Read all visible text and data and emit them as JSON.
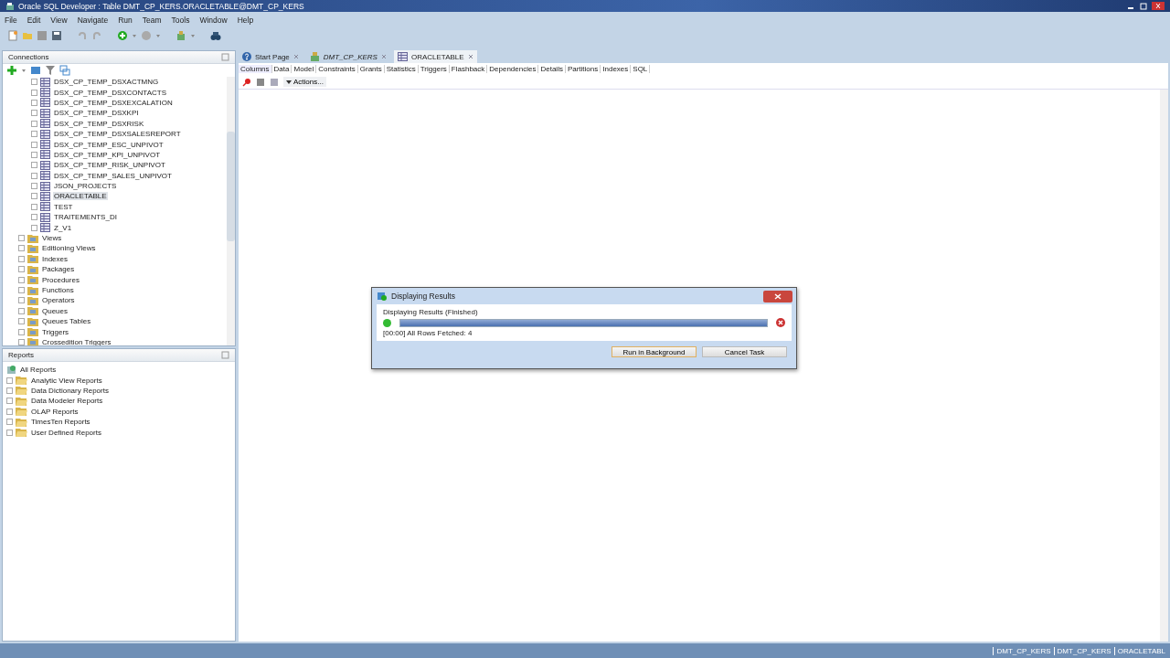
{
  "window": {
    "title": "Oracle SQL Developer : Table DMT_CP_KERS.ORACLETABLE@DMT_CP_KERS"
  },
  "menu": [
    "File",
    "Edit",
    "View",
    "Navigate",
    "Run",
    "Team",
    "Tools",
    "Window",
    "Help"
  ],
  "connections": {
    "title": "Connections",
    "tables": [
      {
        "label": "DSX_CP_TEMP_DSXACTMNG",
        "selected": false
      },
      {
        "label": "DSX_CP_TEMP_DSXCONTACTS",
        "selected": false
      },
      {
        "label": "DSX_CP_TEMP_DSXEXCALATION",
        "selected": false
      },
      {
        "label": "DSX_CP_TEMP_DSXKPI",
        "selected": false
      },
      {
        "label": "DSX_CP_TEMP_DSXRISK",
        "selected": false
      },
      {
        "label": "DSX_CP_TEMP_DSXSALESREPORT",
        "selected": false
      },
      {
        "label": "DSX_CP_TEMP_ESC_UNPIVOT",
        "selected": false
      },
      {
        "label": "DSX_CP_TEMP_KPI_UNPIVOT",
        "selected": false
      },
      {
        "label": "DSX_CP_TEMP_RISK_UNPIVOT",
        "selected": false
      },
      {
        "label": "DSX_CP_TEMP_SALES_UNPIVOT",
        "selected": false
      },
      {
        "label": "JSON_PROJECTS",
        "selected": false
      },
      {
        "label": "ORACLETABLE",
        "selected": true
      },
      {
        "label": "TEST",
        "selected": false
      },
      {
        "label": "TRAITEMENTS_DI",
        "selected": false
      },
      {
        "label": "Z_V1",
        "selected": false
      }
    ],
    "objects": [
      "Views",
      "Editioning Views",
      "Indexes",
      "Packages",
      "Procedures",
      "Functions",
      "Operators",
      "Queues",
      "Queues Tables",
      "Triggers",
      "Crossedition Triggers"
    ]
  },
  "reports": {
    "title": "Reports",
    "root": "All Reports",
    "items": [
      "Analytic View Reports",
      "Data Dictionary Reports",
      "Data Modeler Reports",
      "OLAP Reports",
      "TimesTen Reports",
      "User Defined Reports"
    ]
  },
  "tabs": [
    {
      "label": "Start Page",
      "kind": "help",
      "selected": false
    },
    {
      "label": "DMT_CP_KERS",
      "kind": "connection",
      "selected": false
    },
    {
      "label": "ORACLETABLE",
      "kind": "table",
      "selected": true
    }
  ],
  "subtabs": [
    {
      "label": "Columns",
      "selected": true
    },
    {
      "label": "Data",
      "selected": false
    },
    {
      "label": "Model",
      "selected": false
    },
    {
      "label": "Constraints",
      "selected": false
    },
    {
      "label": "Grants",
      "selected": false
    },
    {
      "label": "Statistics",
      "selected": false
    },
    {
      "label": "Triggers",
      "selected": false
    },
    {
      "label": "Flashback",
      "selected": false
    },
    {
      "label": "Dependencies",
      "selected": false
    },
    {
      "label": "Details",
      "selected": false
    },
    {
      "label": "Partitions",
      "selected": false
    },
    {
      "label": "Indexes",
      "selected": false
    },
    {
      "label": "SQL",
      "selected": false
    }
  ],
  "actions": "Actions...",
  "dialog": {
    "title": "Displaying Results",
    "status": "Displaying Results (Finished)",
    "level": 1,
    "message": "[00:00] All Rows Fetched: 4",
    "buttons": [
      "Run in Background",
      "Cancel Task"
    ]
  },
  "status_bar": [
    "DMT_CP_KERS",
    "DMT_CP_KERS",
    "ORACLETABL"
  ]
}
